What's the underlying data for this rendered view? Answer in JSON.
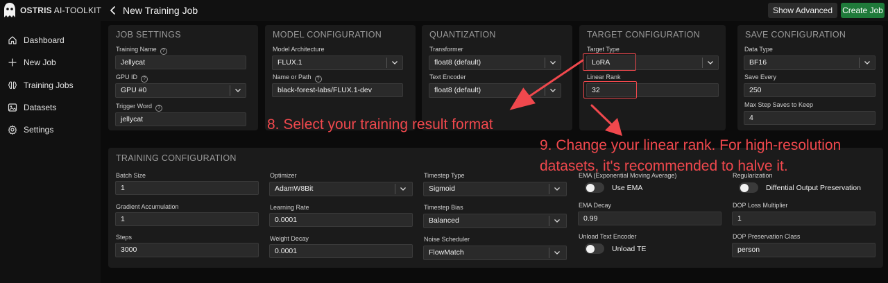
{
  "header": {
    "brand_bold": "OSTRIS",
    "brand_rest": "AI-TOOLKIT",
    "page_title": "New Training Job",
    "show_advanced_label": "Show Advanced",
    "create_job_label": "Create Job"
  },
  "sidebar": {
    "items": [
      {
        "label": "Dashboard",
        "icon": "home-icon"
      },
      {
        "label": "New Job",
        "icon": "plus-icon"
      },
      {
        "label": "Training Jobs",
        "icon": "brain-icon"
      },
      {
        "label": "Datasets",
        "icon": "image-icon"
      },
      {
        "label": "Settings",
        "icon": "gear-icon"
      }
    ]
  },
  "job_settings": {
    "title": "JOB SETTINGS",
    "training_name_label": "Training Name",
    "training_name_value": "Jellycat",
    "gpu_id_label": "GPU ID",
    "gpu_id_value": "GPU #0",
    "trigger_word_label": "Trigger Word",
    "trigger_word_value": "jellycat"
  },
  "model_config": {
    "title": "MODEL CONFIGURATION",
    "architecture_label": "Model Architecture",
    "architecture_value": "FLUX.1",
    "name_or_path_label": "Name or Path",
    "name_or_path_value": "black-forest-labs/FLUX.1-dev"
  },
  "quantization": {
    "title": "QUANTIZATION",
    "transformer_label": "Transformer",
    "transformer_value": "float8 (default)",
    "text_encoder_label": "Text Encoder",
    "text_encoder_value": "float8 (default)"
  },
  "target_config": {
    "title": "TARGET CONFIGURATION",
    "target_type_label": "Target Type",
    "target_type_value": "LoRA",
    "linear_rank_label": "Linear Rank",
    "linear_rank_value": "32"
  },
  "save_config": {
    "title": "SAVE CONFIGURATION",
    "data_type_label": "Data Type",
    "data_type_value": "BF16",
    "save_every_label": "Save Every",
    "save_every_value": "250",
    "max_step_label": "Max Step Saves to Keep",
    "max_step_value": "4"
  },
  "training_config": {
    "title": "TRAINING CONFIGURATION",
    "batch_size_label": "Batch Size",
    "batch_size_value": "1",
    "grad_accum_label": "Gradient Accumulation",
    "grad_accum_value": "1",
    "steps_label": "Steps",
    "steps_value": "3000",
    "optimizer_label": "Optimizer",
    "optimizer_value": "AdamW8Bit",
    "learning_rate_label": "Learning Rate",
    "learning_rate_value": "0.0001",
    "weight_decay_label": "Weight Decay",
    "weight_decay_value": "0.0001",
    "timestep_type_label": "Timestep Type",
    "timestep_type_value": "Sigmoid",
    "timestep_bias_label": "Timestep Bias",
    "timestep_bias_value": "Balanced",
    "noise_scheduler_label": "Noise Scheduler",
    "noise_scheduler_value": "FlowMatch",
    "ema_label": "EMA (Exponential Moving Average)",
    "use_ema_label": "Use EMA",
    "ema_decay_label": "EMA Decay",
    "ema_decay_value": "0.99",
    "unload_te_section_label": "Unload Text Encoder",
    "unload_te_label": "Unload TE",
    "regularization_label": "Regularization",
    "diff_output_label": "Diffential Output Preservation",
    "dop_loss_label": "DOP Loss Multiplier",
    "dop_loss_value": "1",
    "dop_class_label": "DOP Preservation Class",
    "dop_class_value": "person"
  },
  "annotations": {
    "step8": "8. Select your training result format",
    "step9_line1": "9. Change your linear rank. For high-resolution",
    "step9_line2": "datasets, it's recommended to halve it."
  },
  "colors": {
    "accent_green": "#1f7a3a",
    "annotation_red": "#f0484d"
  }
}
